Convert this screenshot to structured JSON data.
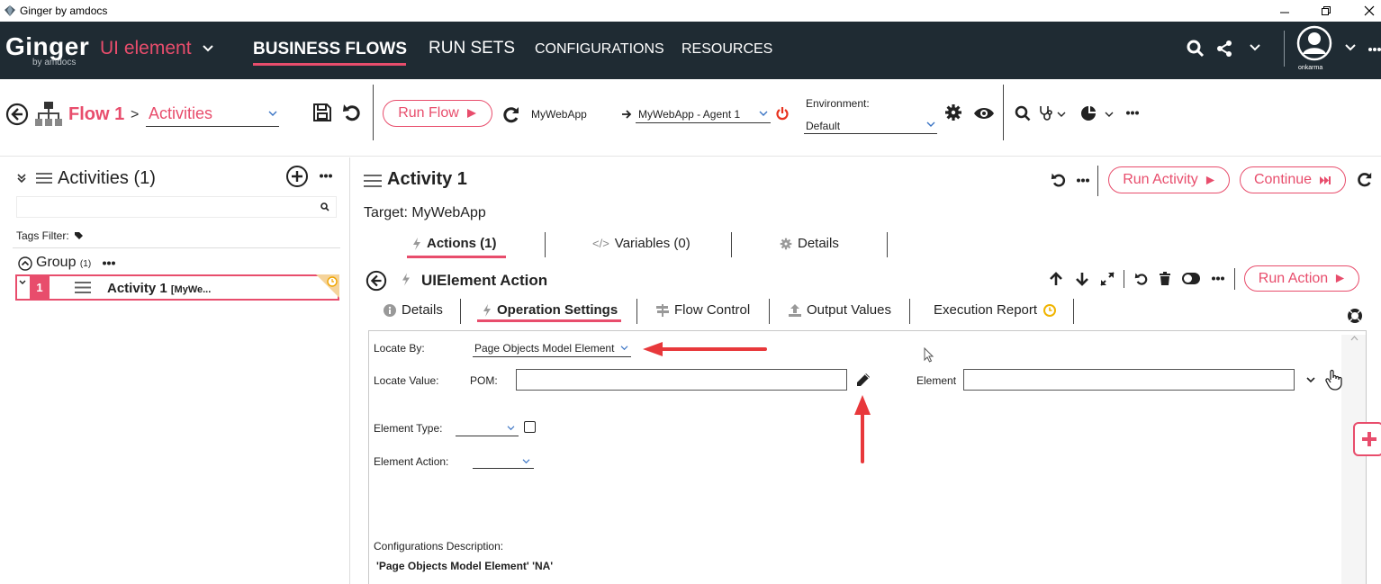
{
  "window": {
    "title": "Ginger by amdocs"
  },
  "topnav": {
    "logo_word": "Ginger",
    "logo_sub": "by amdocs",
    "solution_name": "UI element",
    "tabs": [
      "BUSINESS FLOWS",
      "RUN SETS",
      "CONFIGURATIONS",
      "RESOURCES"
    ],
    "active_tab": "BUSINESS FLOWS",
    "username": "onkarma",
    "accent": "#e84d6c",
    "background": "#1f2b33"
  },
  "toolbar": {
    "flow_name": "Flow 1",
    "separator": ">",
    "section": "Activities",
    "run_flow_label": "Run Flow",
    "target_app": "MyWebApp",
    "agent": "MyWebApp - Agent 1",
    "environment_label": "Environment:",
    "environment_value": "Default"
  },
  "activities_panel": {
    "title": "Activities  (1)",
    "tags_filter_label": "Tags Filter:",
    "group_label": "Group",
    "group_count": "(1)",
    "items": [
      {
        "number": "1",
        "name": "Activity 1",
        "target": "[MyWe..."
      }
    ]
  },
  "activity": {
    "title": "Activity 1",
    "target": "Target: MyWebApp",
    "run_activity_label": "Run Activity",
    "continue_label": "Continue",
    "tabs": [
      {
        "label": "Actions (1)",
        "active": true
      },
      {
        "label": "Variables (0)",
        "active": false
      },
      {
        "label": "Details",
        "active": false
      }
    ]
  },
  "action": {
    "title": "UIElement Action",
    "run_action_label": "Run Action",
    "tabs": [
      {
        "label": "Details",
        "active": false
      },
      {
        "label": "Operation Settings",
        "active": true
      },
      {
        "label": "Flow Control",
        "active": false
      },
      {
        "label": "Output Values",
        "active": false
      },
      {
        "label": "Execution Report",
        "active": false
      }
    ]
  },
  "operation_settings": {
    "locate_by_label": "Locate By:",
    "locate_by_value": "Page Objects Model Element",
    "locate_value_label": "Locate Value:",
    "pom_label": "POM:",
    "pom_value": "",
    "element_label": "Element",
    "element_value": "",
    "element_type_label": "Element Type:",
    "element_type_value": "",
    "element_action_label": "Element Action:",
    "element_action_value": "",
    "config_desc_label": "Configurations Description:",
    "config_desc_value": "'Page Objects Model Element' 'NA'"
  },
  "icons": {
    "back": "back-circle-icon",
    "flow": "sitemap-icon",
    "save": "save-icon",
    "undo": "undo-icon",
    "refresh": "refresh-icon",
    "gear": "gear-icon",
    "eye": "eye-icon",
    "search": "search-icon",
    "share": "share-icon",
    "power": "power-icon",
    "edit": "pencil-icon",
    "help": "lifebuoy-icon"
  }
}
